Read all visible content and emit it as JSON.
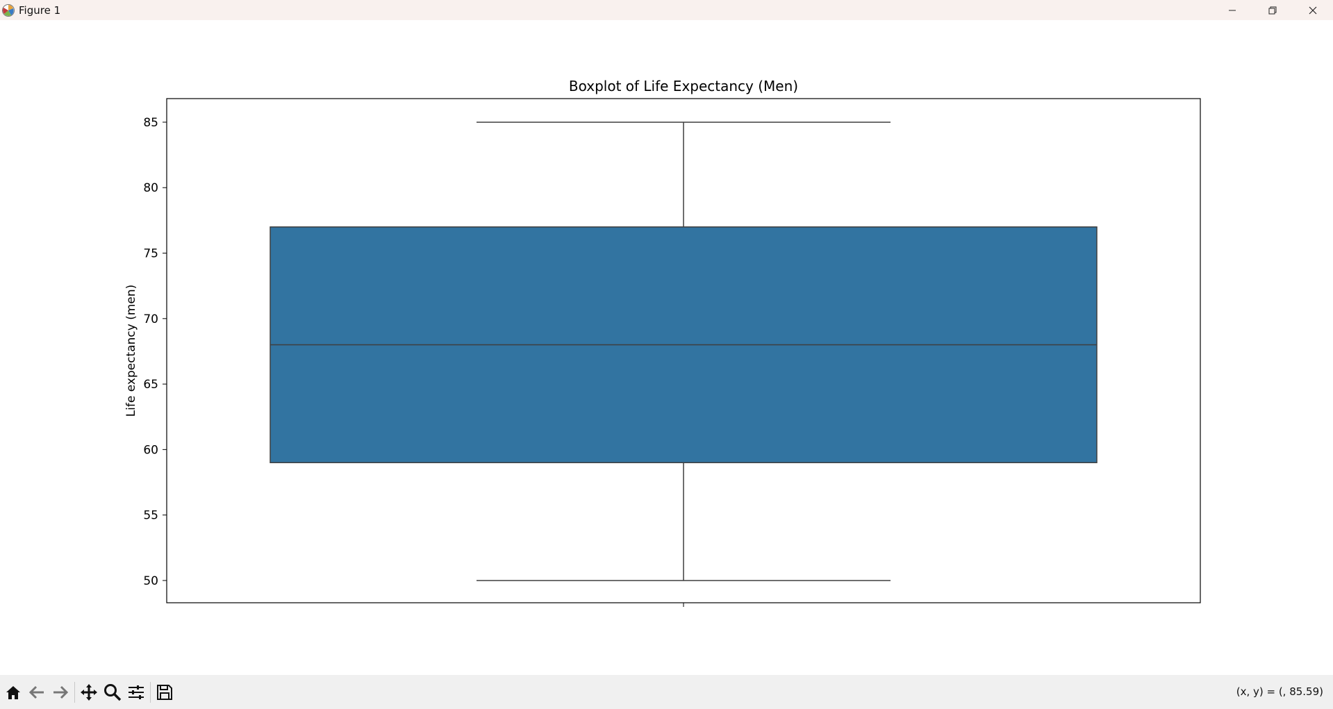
{
  "window": {
    "title": "Figure 1"
  },
  "toolbar": {
    "buttons": [
      {
        "name": "home-button",
        "icon": "home-icon"
      },
      {
        "name": "back-button",
        "icon": "arrow-left-icon"
      },
      {
        "name": "forward-button",
        "icon": "arrow-right-icon"
      },
      {
        "name": "pan-button",
        "icon": "move-icon"
      },
      {
        "name": "zoom-button",
        "icon": "magnifier-icon"
      },
      {
        "name": "configure-subplots-button",
        "icon": "sliders-icon"
      },
      {
        "name": "save-button",
        "icon": "floppy-disk-icon"
      }
    ],
    "coords_text": "(x, y) = (, 85.59)"
  },
  "chart_data": {
    "type": "boxplot",
    "title": "Boxplot of Life Expectancy (Men)",
    "xlabel": "",
    "ylabel": "Life expectancy (men)",
    "ylim": [
      48.3,
      86.8
    ],
    "yticks": [
      50,
      55,
      60,
      65,
      70,
      75,
      80,
      85
    ],
    "box": {
      "whisker_low": 50,
      "q1": 59,
      "median": 68,
      "q3": 77,
      "whisker_high": 85
    },
    "grid": false,
    "colors": {
      "box_fill": "#3274a1",
      "line": "#3f3f3f"
    }
  }
}
